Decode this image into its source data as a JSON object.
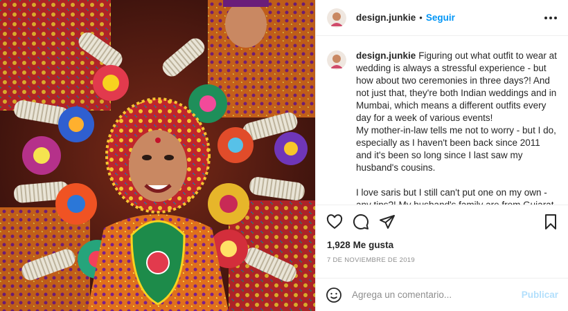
{
  "header": {
    "username": "design.junkie",
    "separator": "•",
    "follow_label": "Seguir",
    "more_icon": "more-horizontal-icon"
  },
  "caption": {
    "username": "design.junkie",
    "text": "Figuring out what outfit to wear at wedding is always a stressful experience - but how about two ceremonies in three days?! And not just that, they're both Indian weddings and in Mumbai, which means a different outfits every day for a week of various events!\nMy mother-in-law tells me not to worry - but I do, especially as I haven't been back since 2011 and it's been so long since I last saw my husband's cousins.\n\nI love saris but I still can't put one on my own - any tips?! My husband's family are from Gujarat and this picture encapsulates garba, a traditional folk dance, in Ahmedabad."
  },
  "actions": {
    "icons": [
      "heart-icon",
      "comment-icon",
      "share-icon",
      "bookmark-icon"
    ]
  },
  "likes": {
    "count": "1,928",
    "label": "Me gusta"
  },
  "date": "7 DE NOVIEMBRE DE 2019",
  "comment_box": {
    "placeholder": "Agrega un comentario...",
    "publish_label": "Publicar"
  },
  "colors": {
    "accent": "#0095f6",
    "publish_disabled": "#b2dffc",
    "text": "#262626",
    "muted": "#8e8e8e"
  }
}
